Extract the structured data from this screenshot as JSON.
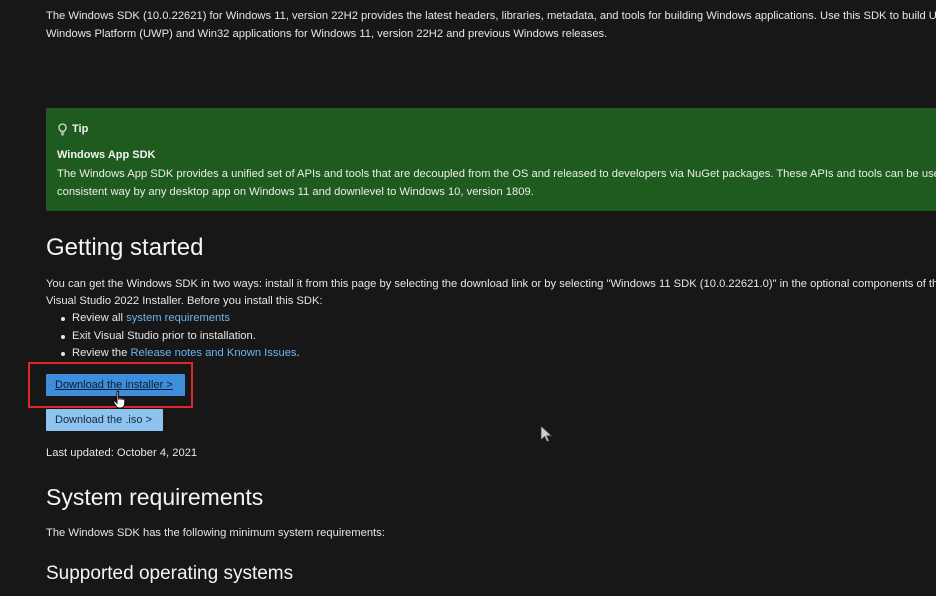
{
  "intro": {
    "line1": "The Windows SDK (10.0.22621) for Windows 11, version 22H2 provides the latest headers, libraries, metadata, and tools for building Windows applications. Use this SDK to build Universal",
    "line2": "Windows Platform (UWP) and Win32 applications for Windows 11, version 22H2 and previous Windows releases."
  },
  "tip": {
    "icon": "lightbulb-icon",
    "label": "Tip",
    "title": "Windows App SDK",
    "body_line1": "The Windows App SDK provides a unified set of APIs and tools that are decoupled from the OS and released to developers via NuGet packages. These APIs and tools can be used in a",
    "body_line2": "consistent way by any desktop app on Windows 11 and downlevel to Windows 10, version 1809.",
    "background": "#1f5b1f"
  },
  "getting_started": {
    "heading": "Getting started",
    "para_line1": "You can get the Windows SDK in two ways: install it from this page by selecting the download link or by selecting \"Windows 11 SDK (10.0.22621.0)\" in the optional components of the",
    "para_line2": "Visual Studio 2022 Installer. Before you install this SDK:",
    "bullets": [
      {
        "prefix": "Review all ",
        "link": "system requirements",
        "suffix": ""
      },
      {
        "prefix": "Exit Visual Studio prior to installation.",
        "link": "",
        "suffix": ""
      },
      {
        "prefix": "Review the ",
        "link": "Release notes and Known Issues",
        "suffix": "."
      }
    ],
    "download_installer": "Download the installer >",
    "download_iso": "Download the .iso >",
    "last_updated": "Last updated: October 4, 2021"
  },
  "system_requirements": {
    "heading": "System requirements",
    "para": "The Windows SDK has the following minimum system requirements:"
  },
  "supported_os": {
    "heading": "Supported operating systems"
  },
  "colors": {
    "page_background": "#171717",
    "link": "#6fb3f2",
    "primary_button": "#3e8edb",
    "secondary_button": "#8ec3f0",
    "highlight_box": "#e0242c"
  }
}
